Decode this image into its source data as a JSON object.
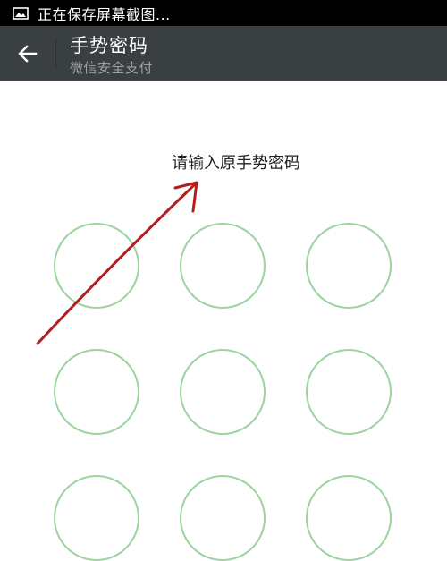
{
  "status_bar": {
    "text": "正在保存屏幕截图...",
    "icon": "image-icon"
  },
  "header": {
    "back_icon": "back-arrow-icon",
    "title": "手势密码",
    "subtitle": "微信安全支付"
  },
  "prompt": "请输入原手势密码",
  "gesture_nodes": 9,
  "colors": {
    "header_bg": "#3a3f41",
    "node_border": "#9cd39f",
    "arrow": "#b01e1e"
  }
}
